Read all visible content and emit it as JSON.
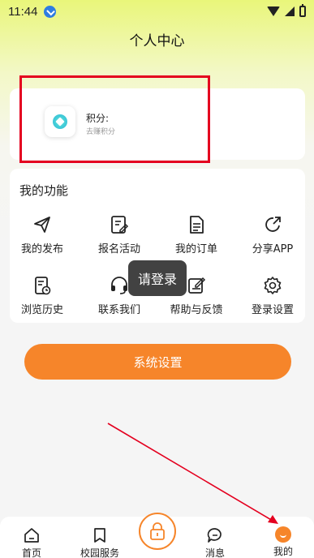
{
  "status_bar": {
    "time": "11:44"
  },
  "header": {
    "title": "个人中心"
  },
  "points": {
    "label": "积分:",
    "link": "去赚积分"
  },
  "functions": {
    "title": "我的功能",
    "items": [
      {
        "label": "我的发布",
        "icon": "send-icon"
      },
      {
        "label": "报名活动",
        "icon": "edit-form-icon"
      },
      {
        "label": "我的订单",
        "icon": "document-icon"
      },
      {
        "label": "分享APP",
        "icon": "share-icon"
      },
      {
        "label": "浏览历史",
        "icon": "history-icon"
      },
      {
        "label": "联系我们",
        "icon": "headset-icon"
      },
      {
        "label": "帮助与反馈",
        "icon": "feedback-icon"
      },
      {
        "label": "登录设置",
        "icon": "gear-icon"
      }
    ]
  },
  "toast": {
    "text": "请登录"
  },
  "system_settings_button": {
    "label": "系统设置"
  },
  "tab_bar": {
    "tabs": [
      {
        "label": "首页",
        "icon": "home-icon"
      },
      {
        "label": "校园服务",
        "icon": "bookmark-icon"
      },
      {
        "label": "消息",
        "icon": "chat-icon"
      },
      {
        "label": "我的",
        "icon": "profile-icon"
      }
    ],
    "center_icon": "lock-icon"
  },
  "colors": {
    "accent": "#f6852a",
    "highlight": "#e4001f",
    "annotation": "#e4001f"
  }
}
